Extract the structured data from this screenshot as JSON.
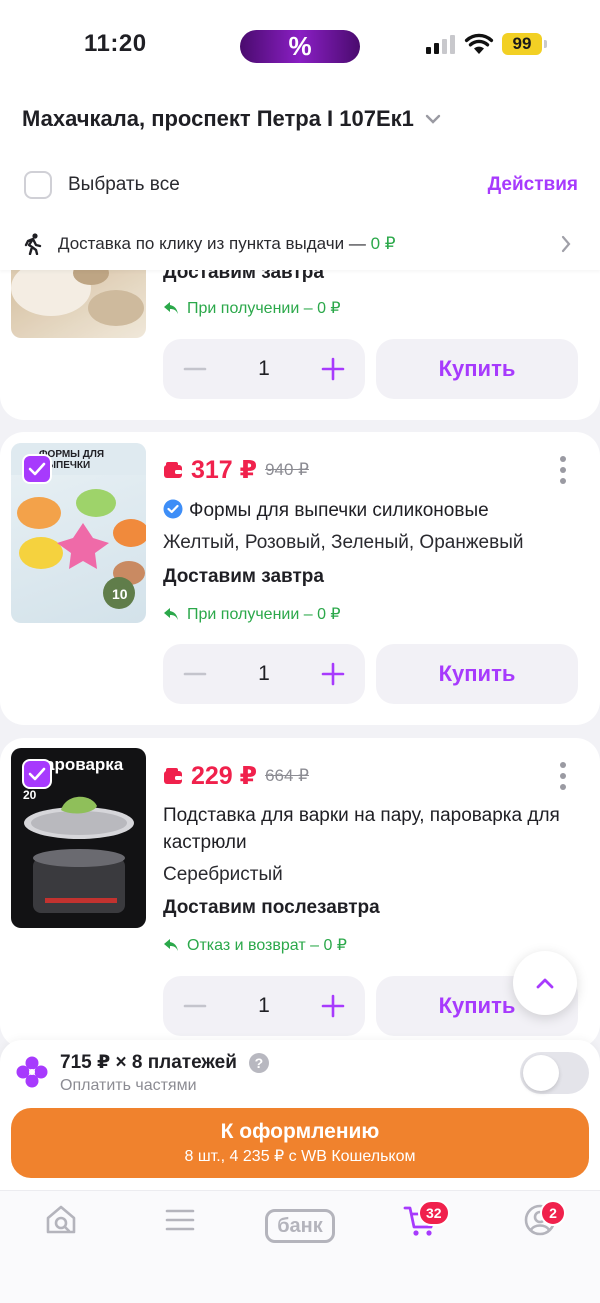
{
  "status_bar": {
    "time": "11:20",
    "promo_symbol": "%",
    "battery": "99"
  },
  "header": {
    "address": "Махачкала, проспект Петра I 107Ек1",
    "select_all_label": "Выбрать все",
    "actions_label": "Действия"
  },
  "delivery_banner": {
    "text": "Доставка по клику из пункта выдачи — ",
    "price": "0 ₽"
  },
  "products": [
    {
      "delivery": "Доставим завтра",
      "return_text": "При получении – 0 ₽",
      "quantity": "1",
      "buy_label": "Купить"
    },
    {
      "price": "317 ₽",
      "old_price": "940 ₽",
      "title": "Формы для выпечки силиконовые",
      "attributes": "Желтый, Розовый, Зеленый, Оранжевый",
      "delivery": "Доставим завтра",
      "return_text": "При получении – 0 ₽",
      "quantity": "1",
      "buy_label": "Купить",
      "image_label": "ФОРМЫ ДЛЯ ВЫПЕЧКИ",
      "image_count": "10",
      "selected": true,
      "verified": true
    },
    {
      "price": "229 ₽",
      "old_price": "664 ₽",
      "title": "Подставка для варки на пару, пароварка для кастрюли",
      "attributes": "Серебристый",
      "delivery": "Доставим послезавтра",
      "return_text": "Отказ и возврат – 0 ₽",
      "quantity": "1",
      "buy_label": "Купить",
      "image_label": "ароварка",
      "image_size": "20",
      "selected": true,
      "verified": false
    }
  ],
  "installments": {
    "main": "715 ₽ × 8 платежей",
    "sub": "Оплатить частями",
    "help": "?",
    "enabled": false
  },
  "checkout": {
    "label": "К оформлению",
    "details": "8 шт., 4 235 ₽ с WB Кошельком"
  },
  "tabbar": {
    "bank_label": "банк",
    "cart_badge": "32",
    "profile_badge": "2"
  },
  "colors": {
    "accent": "#a73afd",
    "price": "#f0214c",
    "checkout": "#f0822d",
    "success": "#2ba84a"
  }
}
